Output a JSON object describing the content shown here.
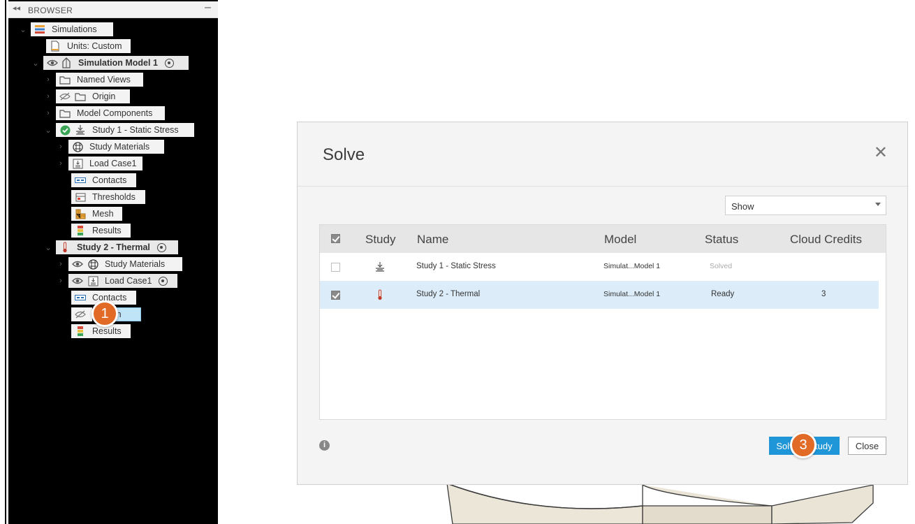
{
  "browser": {
    "title": "BROWSER",
    "collapse_glyph": "◂◂",
    "minimize_glyph": "–",
    "tree": {
      "simulations": "Simulations",
      "units": "Units: Custom",
      "sim_model": "Simulation Model 1",
      "named_views": "Named Views",
      "origin": "Origin",
      "model_components": "Model Components",
      "study1": "Study 1 - Static Stress",
      "study1_materials": "Study Materials",
      "study1_loadcase": "Load Case1",
      "study1_contacts": "Contacts",
      "study1_thresholds": "Thresholds",
      "study1_mesh": "Mesh",
      "study1_results": "Results",
      "study2": "Study 2 - Thermal",
      "study2_materials": "Study Materials",
      "study2_loadcase": "Load Case1",
      "study2_contacts": "Contacts",
      "study2_mesh": "Mesh",
      "study2_results": "Results"
    }
  },
  "callouts": {
    "one": "1",
    "three": "3"
  },
  "dialog": {
    "title": "Solve",
    "close_glyph": "✕",
    "show_select": "Show",
    "columns": {
      "study": "Study",
      "name": "Name",
      "model": "Model",
      "status": "Status",
      "credits": "Cloud Credits"
    },
    "rows": [
      {
        "name": "Study 1 - Static Stress",
        "model": "Simulat...Model 1",
        "status": "Solved",
        "credits": "",
        "checked": false,
        "icon": "static-stress-icon"
      },
      {
        "name": "Study 2 - Thermal",
        "model": "Simulat...Model 1",
        "status": "Ready",
        "credits": "3",
        "checked": true,
        "icon": "thermometer-icon"
      }
    ],
    "info_glyph": "i",
    "solve_button": "Solve 1 Study",
    "close_button": "Close"
  },
  "colors": {
    "accent": "#1f96d8",
    "callout": "#e06a26",
    "selected_row": "#dcedf9",
    "check_green": "#3aa655"
  }
}
